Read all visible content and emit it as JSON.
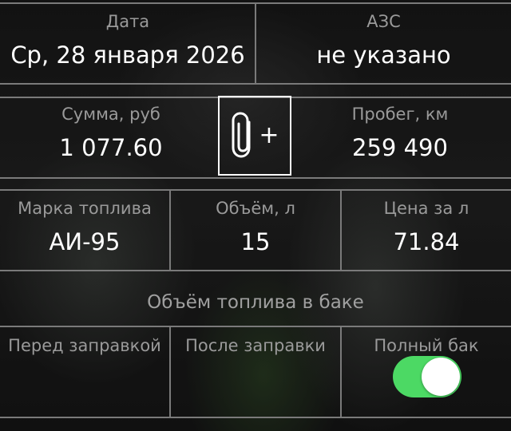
{
  "row1": {
    "date_label": "Дата",
    "date_value": "Ср, 28 января 2026",
    "station_label": "АЗС",
    "station_value": "не указано"
  },
  "row2": {
    "sum_label": "Сумма, руб",
    "sum_value": "1 077.60",
    "attach_icon": "paperclip-plus-icon",
    "attach_plus": "+",
    "mileage_label": "Пробег, км",
    "mileage_value": "259 490"
  },
  "row3": {
    "fuel_label": "Марка топлива",
    "fuel_value": "АИ-95",
    "volume_label": "Объём, л",
    "volume_value": "15",
    "price_label": "Цена за л",
    "price_value": "71.84"
  },
  "tank": {
    "title": "Объём топлива в баке",
    "before_label": "Перед заправкой",
    "after_label": "После заправки",
    "full_label": "Полный бак",
    "full_tank_on": true
  },
  "colors": {
    "toggle_on": "#4cd964",
    "label": "#9a9a9a",
    "value": "#ffffff",
    "divider": "#7a7a7a"
  }
}
